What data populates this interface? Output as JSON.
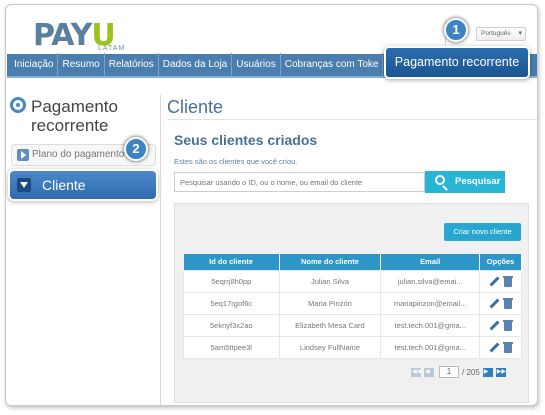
{
  "header": {
    "logo_pay": "PAY",
    "logo_u": "U",
    "logo_sub": "LATAM",
    "language": "Português"
  },
  "nav": {
    "items": [
      "Iniciação",
      "Resumo",
      "Relatórios",
      "Dados da Loja",
      "Usuários",
      "Cobranças com Toke"
    ],
    "active": "Pagamento recorrente"
  },
  "badges": {
    "one": "1",
    "two": "2"
  },
  "sidebar": {
    "title_line1": "Pagamento",
    "title_line2": "recorrente",
    "items": [
      {
        "label": "Plano do pagamento"
      },
      {
        "label": "Cliente"
      }
    ]
  },
  "main": {
    "title": "Cliente",
    "section_title": "Seus clientes criados",
    "section_subtitle": "Estes são os clientes que você criou.",
    "search_placeholder": "Pesquisar usando o ID, ou o nome, ou email do cliente",
    "search_button": "Pesquisar",
    "new_client_button": "Criar novo cliente",
    "table": {
      "columns": [
        "Id do cliente",
        "Nome do cliente",
        "Email",
        "Opções"
      ],
      "rows": [
        {
          "id": "5eqrrj8h0pp",
          "name": "Julian Silva",
          "email": "julian.silva@emai..."
        },
        {
          "id": "5eq17rgof6c",
          "name": "Maria Pinzón",
          "email": "mariapinzon@email..."
        },
        {
          "id": "5eknyf3x2ao",
          "name": "Elizabeth Mesa Card",
          "email": "test.tech.001@gma..."
        },
        {
          "id": "5am5ttpee3l",
          "name": "Lindsey FullName",
          "email": "test.tech.001@gma..."
        }
      ]
    },
    "pager": {
      "current": "1",
      "total": "/ 205"
    }
  }
}
